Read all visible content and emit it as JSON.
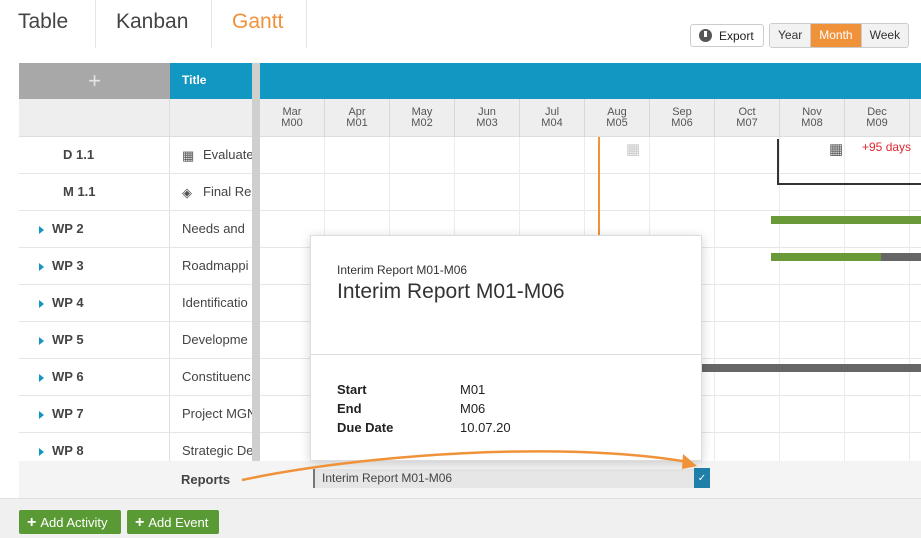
{
  "views": [
    {
      "label": "Table",
      "active": false
    },
    {
      "label": "Kanban",
      "active": false
    },
    {
      "label": "Gantt",
      "active": true
    }
  ],
  "toolbar": {
    "export_label": "Export",
    "zoom_options": [
      "Year",
      "Month",
      "Week"
    ],
    "zoom_active": "Month"
  },
  "grid": {
    "add_symbol": "+",
    "title_header": "Title",
    "months": [
      {
        "name": "Mar",
        "code": "M00"
      },
      {
        "name": "Apr",
        "code": "M01"
      },
      {
        "name": "May",
        "code": "M02"
      },
      {
        "name": "Jun",
        "code": "M03"
      },
      {
        "name": "Jul",
        "code": "M04"
      },
      {
        "name": "Aug",
        "code": "M05"
      },
      {
        "name": "Sep",
        "code": "M06"
      },
      {
        "name": "Oct",
        "code": "M07"
      },
      {
        "name": "Nov",
        "code": "M08"
      },
      {
        "name": "Dec",
        "code": "M09"
      }
    ],
    "rows": [
      {
        "id": "D 1.1",
        "title": "Evaluate",
        "icon": "deliverable-icon",
        "expandable": false
      },
      {
        "id": "M 1.1",
        "title": "Final Re",
        "icon": "milestone-icon",
        "expandable": false
      },
      {
        "id": "WP 2",
        "title": "Needs and",
        "expandable": true
      },
      {
        "id": "WP 3",
        "title": "Roadmappi",
        "expandable": true
      },
      {
        "id": "WP 4",
        "title": "Identificatio",
        "expandable": true
      },
      {
        "id": "WP 5",
        "title": "Developme",
        "expandable": true
      },
      {
        "id": "WP 6",
        "title": "Constituenc",
        "expandable": true
      },
      {
        "id": "WP 7",
        "title": "Project MGN",
        "expandable": true
      },
      {
        "id": "WP 8",
        "title": "Strategic De",
        "expandable": true
      }
    ],
    "reports_label": "Reports",
    "report_bar_label": "Interim Report M01-M06",
    "delay_label": "+95 days"
  },
  "popover": {
    "subtitle": "Interim Report M01-M06",
    "title": "Interim Report M01-M06",
    "fields": [
      {
        "key": "Start",
        "value": "M01"
      },
      {
        "key": "End",
        "value": "M06"
      },
      {
        "key": "Due Date",
        "value": "10.07.20"
      }
    ]
  },
  "actions": {
    "add_activity": "Add Activity",
    "add_event": "Add Event"
  },
  "colors": {
    "accent": "#f0923a",
    "header_blue": "#1296c2",
    "bar_green": "#6a9a37",
    "bar_dark": "#666666",
    "delay_red": "#e0252f",
    "button_green": "#5a9a34"
  }
}
